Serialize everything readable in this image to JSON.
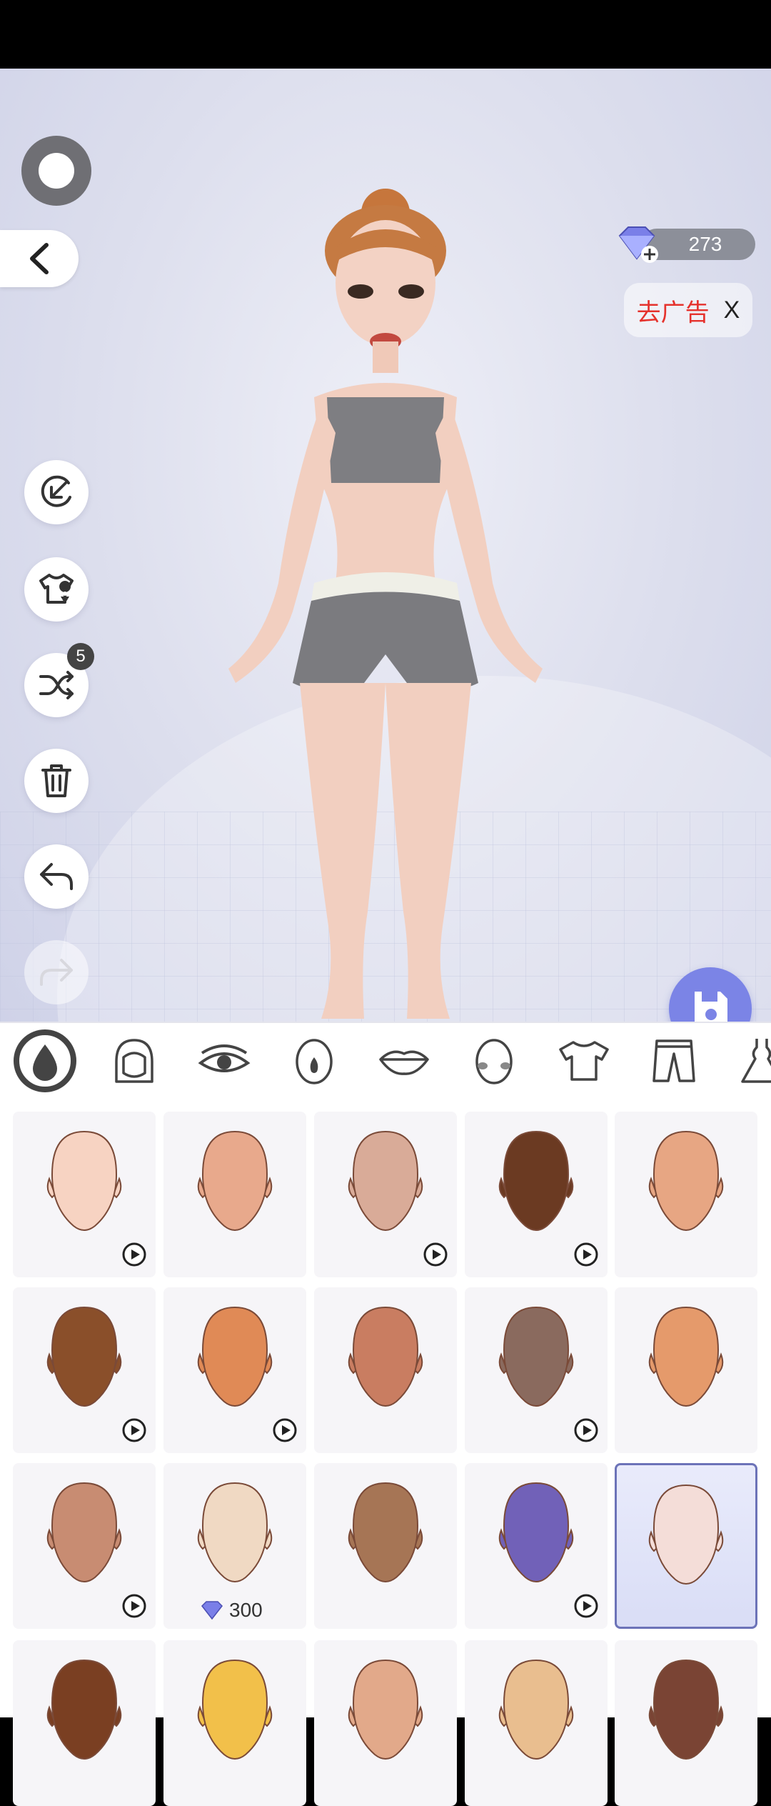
{
  "status_bar": {},
  "header": {
    "gems": "273",
    "remove_ads_label": "去广告",
    "remove_ads_close": "X"
  },
  "side_tools": {
    "random_badge": "5"
  },
  "tabs": [
    "skin",
    "hair",
    "eyes",
    "nose",
    "lips",
    "blush",
    "tops",
    "bottoms",
    "dresses"
  ],
  "colors": {
    "accent": "#7b84e6",
    "selected_border": "#6c73b8",
    "remove_ads_text": "#e5322d"
  },
  "skin_tiles": [
    {
      "color": "#f7d3c2",
      "badge": "video"
    },
    {
      "color": "#e8a98c",
      "badge": "none"
    },
    {
      "color": "#d9ab98",
      "badge": "video"
    },
    {
      "color": "#6b3a22",
      "badge": "video"
    },
    {
      "color": "#e7a683",
      "badge": "none"
    },
    {
      "color": "#8a4f2a",
      "badge": "video"
    },
    {
      "color": "#e08a56",
      "badge": "video"
    },
    {
      "color": "#c97d61",
      "badge": "none"
    },
    {
      "color": "#8a6a5e",
      "badge": "video"
    },
    {
      "color": "#e59a6b",
      "badge": "none"
    },
    {
      "color": "#c88c72",
      "badge": "video"
    },
    {
      "color": "#f0d9c3",
      "badge": "price",
      "price": "300"
    },
    {
      "color": "#a67555",
      "badge": "none"
    },
    {
      "color": "#7161b8",
      "badge": "video"
    },
    {
      "color": "#f4ddd8",
      "badge": "selected"
    },
    {
      "color": "#7a3f22",
      "badge": "none"
    },
    {
      "color": "#f2c04a",
      "badge": "none"
    },
    {
      "color": "#e2a98a",
      "badge": "none"
    },
    {
      "color": "#e9be8f",
      "badge": "none"
    },
    {
      "color": "#7a4434",
      "badge": "none"
    }
  ]
}
